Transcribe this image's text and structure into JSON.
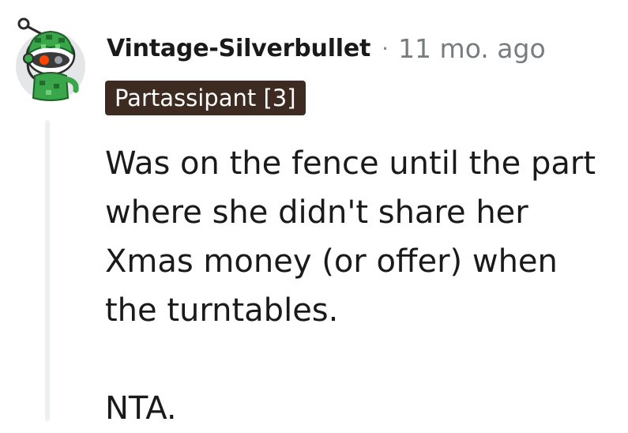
{
  "comment": {
    "author": "Vintage-Silverbullet",
    "separator": "·",
    "timestamp": "11 mo. ago",
    "flair": "Partassipant [3]",
    "paragraphs": [
      "Was on the fence until the part where she didn't share her Xmas money (or offer) when the turntables.",
      "NTA."
    ],
    "avatar_icon": "snoo-avatar-icon",
    "flair_color": "#3d2a21"
  }
}
